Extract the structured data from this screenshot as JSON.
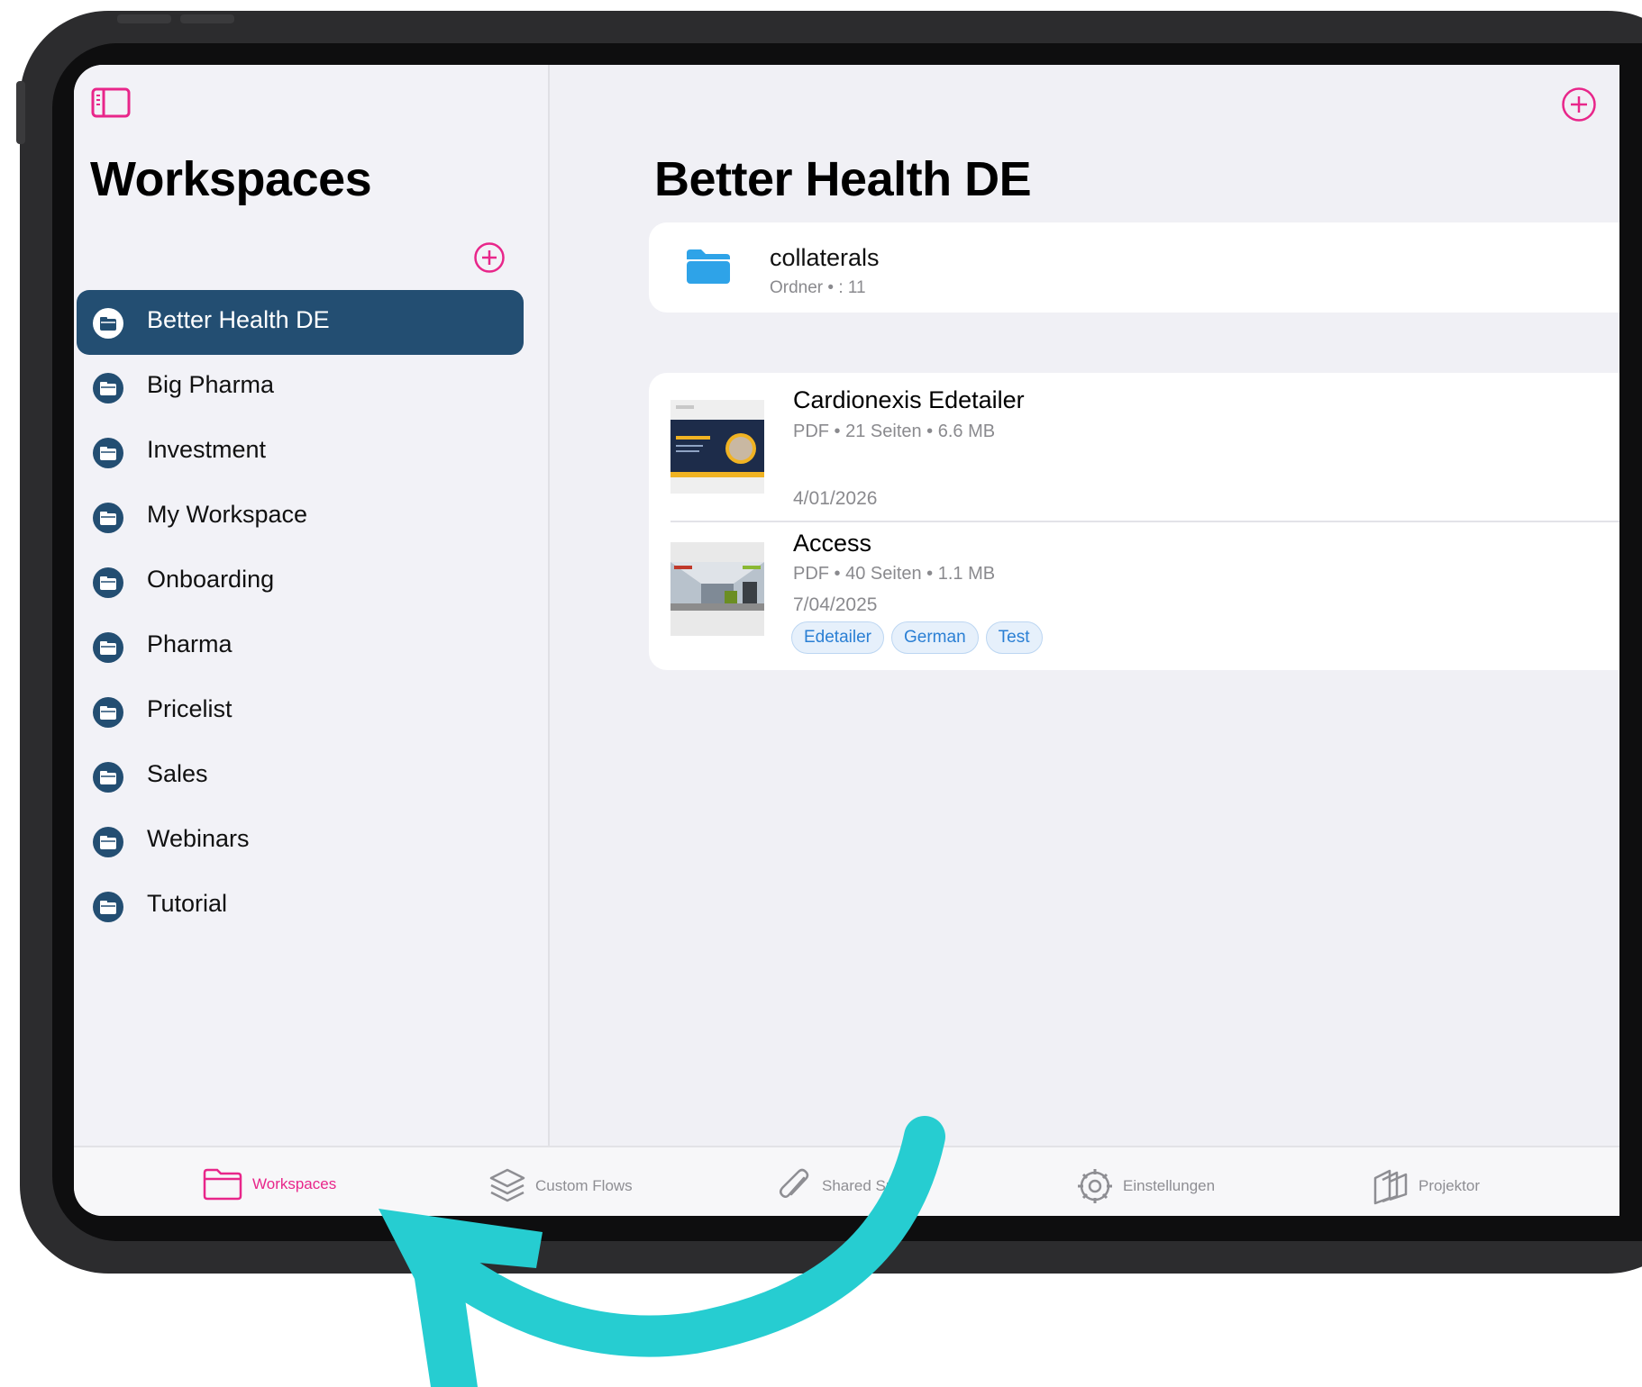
{
  "sidebar": {
    "title": "Workspaces",
    "items": [
      {
        "label": "Better Health DE"
      },
      {
        "label": "Big Pharma"
      },
      {
        "label": "Investment"
      },
      {
        "label": "My Workspace"
      },
      {
        "label": "Onboarding"
      },
      {
        "label": "Pharma"
      },
      {
        "label": "Pricelist"
      },
      {
        "label": "Sales"
      },
      {
        "label": "Webinars"
      },
      {
        "label": "Tutorial"
      }
    ],
    "selected_index": 0
  },
  "main": {
    "title": "Better Health DE",
    "folder": {
      "name": "collaterals",
      "meta": "Ordner • : 11"
    },
    "documents": [
      {
        "title": "Cardionexis Edetailer",
        "meta": "PDF • 21 Seiten • 6.6 MB",
        "date": "4/01/2026",
        "tags": []
      },
      {
        "title": "Access",
        "meta": "PDF • 40 Seiten • 1.1 MB",
        "date": "7/04/2025",
        "tags": [
          "Edetailer",
          "German",
          "Test"
        ]
      }
    ]
  },
  "tabbar": {
    "items": [
      {
        "label": "Workspaces",
        "icon": "folder-icon",
        "active": true
      },
      {
        "label": "Custom Flows",
        "icon": "layers-icon",
        "active": false
      },
      {
        "label": "Shared Spaces",
        "icon": "paperclip-icon",
        "active": false
      },
      {
        "label": "Einstellungen",
        "icon": "gear-icon",
        "active": false
      },
      {
        "label": "Projektor",
        "icon": "projector-icon",
        "active": false
      }
    ]
  },
  "colors": {
    "accent": "#e8268a",
    "sidebar_selected": "#234e72",
    "folder": "#2ea3e8",
    "tag": "#2a7fd4",
    "annotation_arrow": "#26cdd1"
  }
}
